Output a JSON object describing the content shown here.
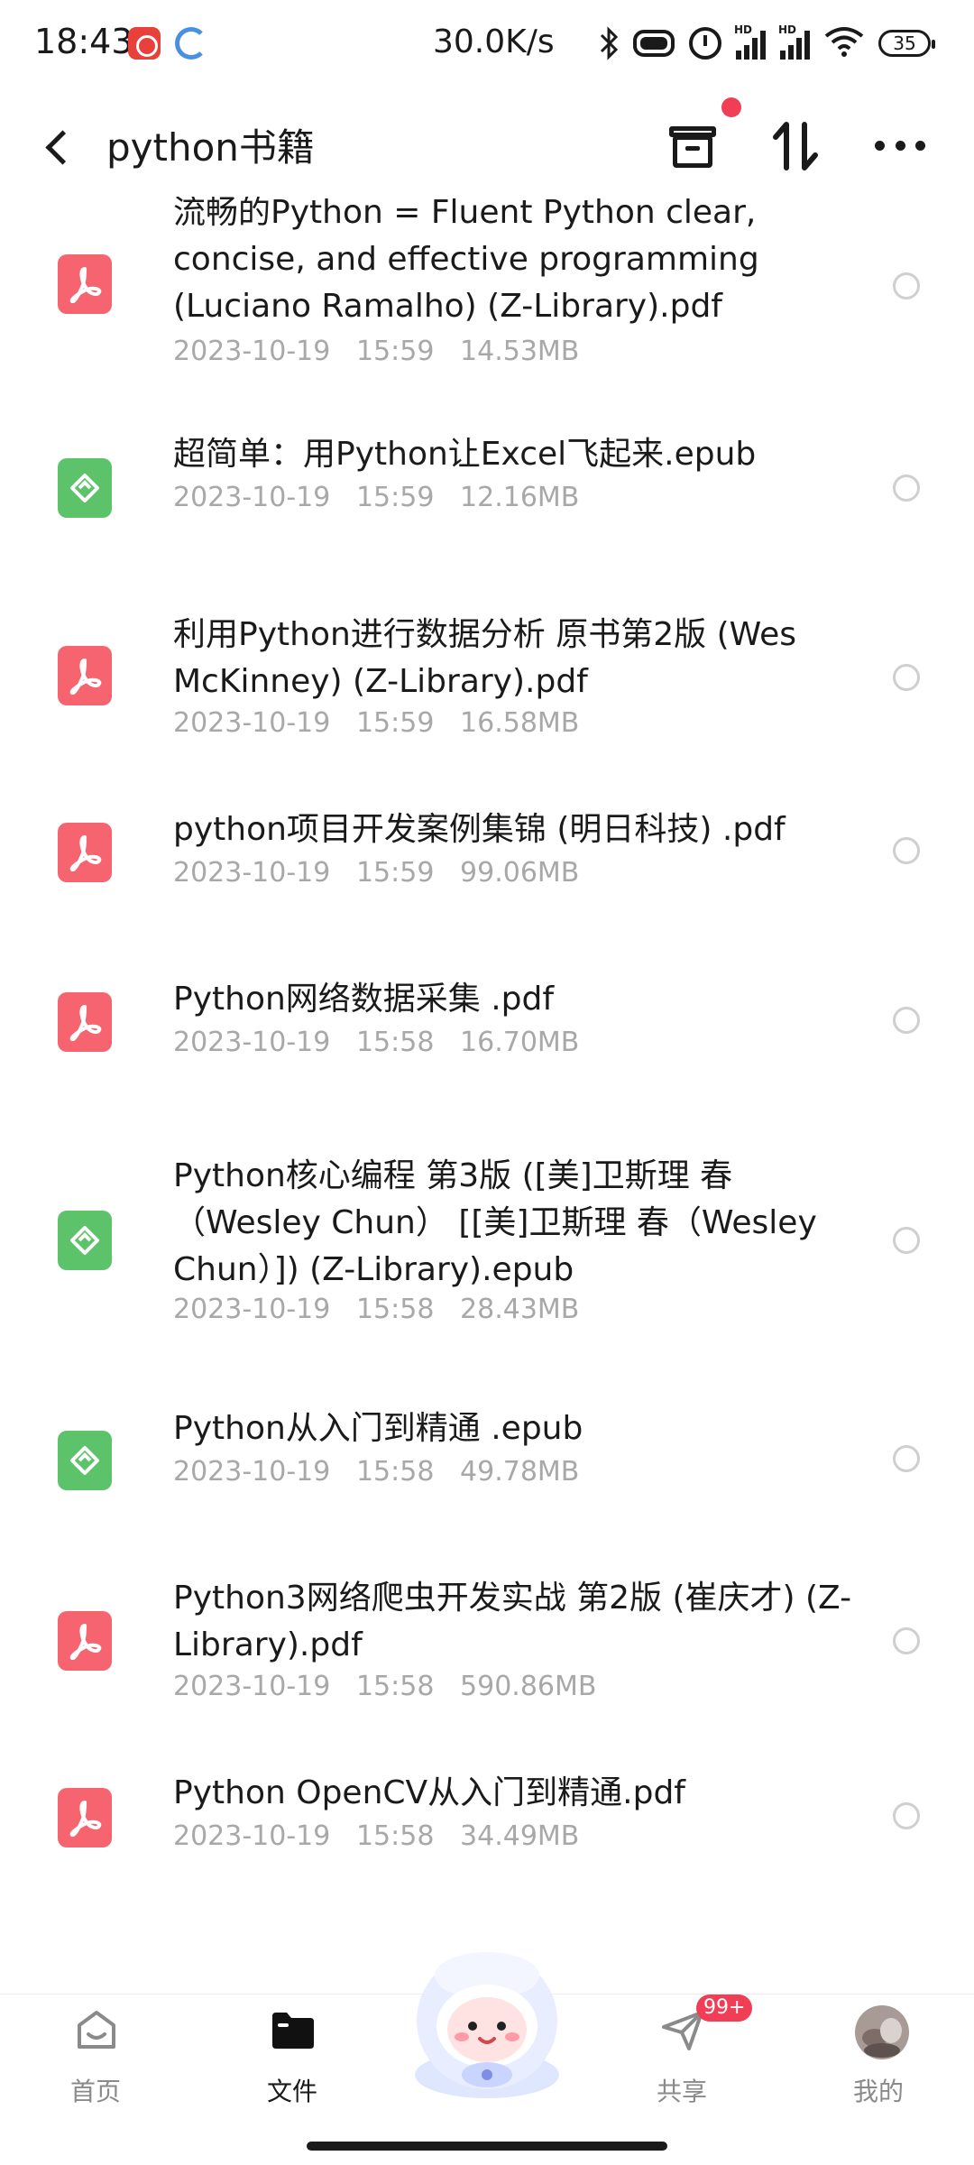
{
  "status_bar": {
    "time": "18:43",
    "network_speed": "30.0K/s",
    "battery": "35",
    "signal_label": "HD"
  },
  "header": {
    "back_icon": "chevron-left-icon",
    "title": "python书籍",
    "notification_dot_color": "#ef3e55"
  },
  "files": [
    {
      "type": "pdf",
      "name": "流畅的Python = Fluent Python clear, concise, and effective programming (Luciano Ramalho) (Z-Library).pdf",
      "meta": "2023-10-19   15:59   14.53MB"
    },
    {
      "type": "epub",
      "name": "超简单：用Python让Excel飞起来.epub",
      "meta": "2023-10-19   15:59   12.16MB"
    },
    {
      "type": "pdf",
      "name": "利用Python进行数据分析 原书第2版 (Wes McKinney) (Z-Library).pdf",
      "meta": "2023-10-19   15:59   16.58MB"
    },
    {
      "type": "pdf",
      "name": "python项目开发案例集锦 (明日科技) .pdf",
      "meta": "2023-10-19   15:59   99.06MB"
    },
    {
      "type": "pdf",
      "name": "Python网络数据采集 .pdf",
      "meta": "2023-10-19   15:58   16.70MB"
    },
    {
      "type": "epub",
      "name": "Python核心编程 第3版 ([美]卫斯理 春（Wesley Chun） [[美]卫斯理 春（Wesley Chun）]) (Z-Library).epub",
      "meta": "2023-10-19   15:58   28.43MB"
    },
    {
      "type": "epub",
      "name": "Python从入门到精通 .epub",
      "meta": "2023-10-19   15:58   49.78MB"
    },
    {
      "type": "pdf",
      "name": "Python3网络爬虫开发实战 第2版 (崔庆才) (Z-Library).pdf",
      "meta": "2023-10-19   15:58   590.86MB"
    },
    {
      "type": "pdf",
      "name": "Python OpenCV从入门到精通.pdf",
      "meta": "2023-10-19   15:58   34.49MB"
    }
  ],
  "bottom_nav": {
    "home": "首页",
    "files": "文件",
    "share": "共享",
    "share_badge": "99+",
    "me": "我的"
  },
  "colors": {
    "pdf": "#f5646f",
    "epub": "#5dc36a",
    "accent": "#ef3e55"
  }
}
